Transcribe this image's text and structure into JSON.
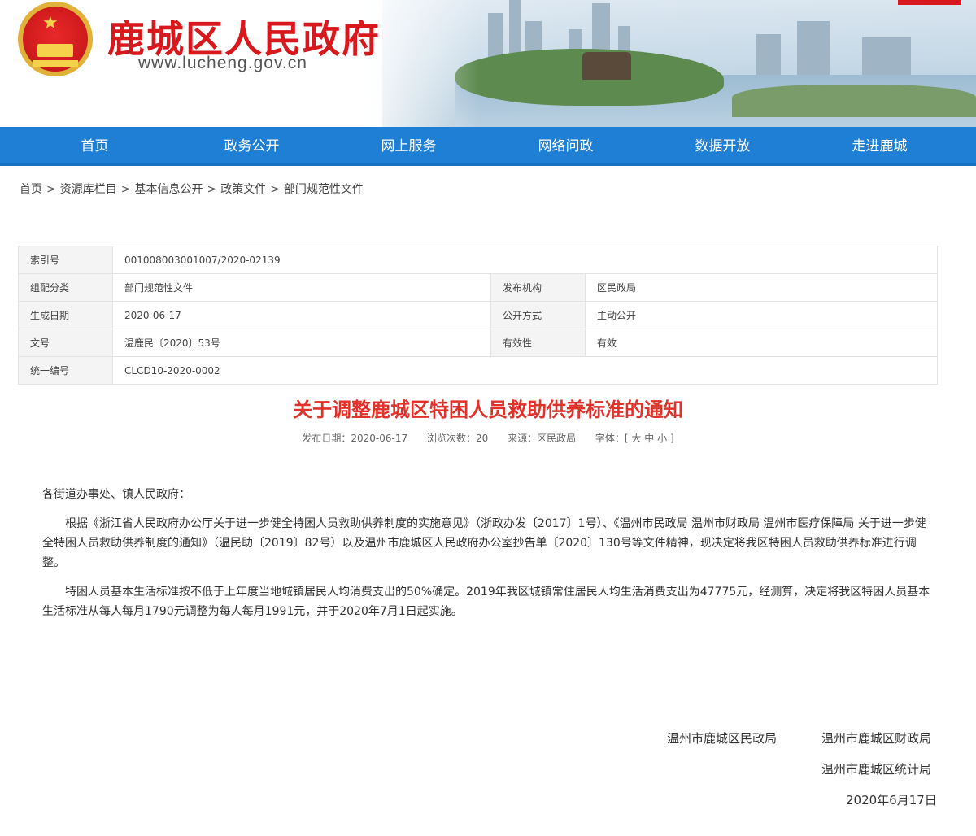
{
  "header": {
    "site_title": "鹿城区人民政府",
    "site_url": "www.lucheng.gov.cn"
  },
  "nav": {
    "items": [
      "首页",
      "政务公开",
      "网上服务",
      "网络问政",
      "数据开放",
      "走进鹿城"
    ]
  },
  "breadcrumb": {
    "items": [
      "首页",
      "资源库栏目",
      "基本信息公开",
      "政策文件",
      "部门规范性文件"
    ],
    "separator": ">"
  },
  "meta": {
    "index_label": "索引号",
    "index_value": "001008003001007/2020-02139",
    "category_label": "组配分类",
    "category_value": "部门规范性文件",
    "publisher_label": "发布机构",
    "publisher_value": "区民政局",
    "date_label": "生成日期",
    "date_value": "2020-06-17",
    "method_label": "公开方式",
    "method_value": "主动公开",
    "docno_label": "文号",
    "docno_value": "温鹿民〔2020〕53号",
    "validity_label": "有效性",
    "validity_value": "有效",
    "code_label": "统一编号",
    "code_value": "CLCD10-2020-0002"
  },
  "article": {
    "title": "关于调整鹿城区特困人员救助供养标准的通知",
    "publish_date": "发布日期：2020-06-17",
    "views": "浏览次数：20",
    "source": "来源：区民政局",
    "font_label": "字体：",
    "font_large": "大",
    "font_medium": "中",
    "font_small": "小",
    "salutation": "各街道办事处、镇人民政府：",
    "para1": "根据《浙江省人民政府办公厅关于进一步健全特困人员救助供养制度的实施意见》（浙政办发〔2017〕1号）、《温州市民政局 温州市财政局 温州市医疗保障局 关于进一步健全特困人员救助供养制度的通知》（温民助〔2019〕82号）以及温州市鹿城区人民政府办公室抄告单〔2020〕130号等文件精神，现决定将我区特困人员救助供养标准进行调整。",
    "para2": "特困人员基本生活标准按不低于上年度当地城镇居民人均消费支出的50%确定。2019年我区城镇常住居民人均生活消费支出为47775元，经测算，决定将我区特困人员基本生活标准从每人每月1790元调整为每人每月1991元，并于2020年7月1日起实施。"
  },
  "signatures": {
    "org1": "温州市鹿城区民政局",
    "org2": "温州市鹿城区财政局",
    "org3": "温州市鹿城区统计局",
    "date": "2020年6月17日"
  },
  "colors": {
    "brand_red": "#d8181c",
    "nav_blue": "#1f7fd4",
    "title_red": "#e0322a"
  }
}
